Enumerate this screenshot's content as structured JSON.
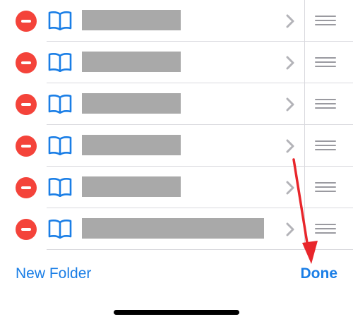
{
  "bookmarks": [
    {
      "title_redacted": true,
      "delete_icon": "minus-circle-icon",
      "icon": "book-icon",
      "chevron": "chevron-right-icon",
      "handle": "reorder-handle-icon"
    },
    {
      "title_redacted": true,
      "delete_icon": "minus-circle-icon",
      "icon": "book-icon",
      "chevron": "chevron-right-icon",
      "handle": "reorder-handle-icon"
    },
    {
      "title_redacted": true,
      "delete_icon": "minus-circle-icon",
      "icon": "book-icon",
      "chevron": "chevron-right-icon",
      "handle": "reorder-handle-icon"
    },
    {
      "title_redacted": true,
      "delete_icon": "minus-circle-icon",
      "icon": "book-icon",
      "chevron": "chevron-right-icon",
      "handle": "reorder-handle-icon"
    },
    {
      "title_redacted": true,
      "delete_icon": "minus-circle-icon",
      "icon": "book-icon",
      "chevron": "chevron-right-icon",
      "handle": "reorder-handle-icon"
    },
    {
      "title_redacted": true,
      "delete_icon": "minus-circle-icon",
      "icon": "book-icon",
      "chevron": "chevron-right-icon",
      "handle": "reorder-handle-icon"
    }
  ],
  "toolbar": {
    "new_folder_label": "New Folder",
    "done_label": "Done"
  },
  "colors": {
    "accent": "#1a7ee6",
    "delete": "#f4433a",
    "redaction": "#a9a9a9",
    "annotation_arrow": "#e8262b"
  }
}
